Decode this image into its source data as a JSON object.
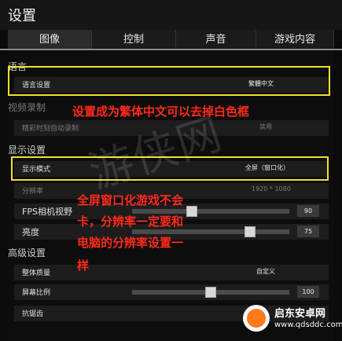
{
  "window": {
    "title": "设置"
  },
  "tabs": [
    {
      "label": "图像",
      "active": true
    },
    {
      "label": "控制",
      "active": false
    },
    {
      "label": "声音",
      "active": false
    },
    {
      "label": "游戏内容",
      "active": false
    }
  ],
  "sections": {
    "language": "语言",
    "video_recording": "视频录制",
    "display": "显示设置",
    "advanced": "高级设置"
  },
  "rows": {
    "language_setting": {
      "label": "语言设置",
      "value": "繁體中文"
    },
    "auto_record": {
      "label": "精彩时刻自动录制",
      "value": "禁用"
    },
    "display_mode": {
      "label": "显示模式",
      "value": "全屏（窗口化）"
    },
    "resolution": {
      "label": "分辨率",
      "value": "1920 * 1080"
    },
    "fps_fov": {
      "label": "FPS相机视野",
      "value": "90",
      "level": 0.38
    },
    "brightness": {
      "label": "亮度",
      "value": "75",
      "level": 0.75
    },
    "overall_quality": {
      "label": "整体质量",
      "value": "自定义"
    },
    "screen_scale": {
      "label": "屏幕比例",
      "value": "100",
      "level": 0.5
    },
    "anti_aliasing": {
      "label": "抗锯齿"
    }
  },
  "annotations": {
    "note1": "设置成为繁体中文可以去掉白色框",
    "note2_line1": "全屏窗口化游戏不会",
    "note2_line2": "卡，分辨率一定要和",
    "note2_line3": "电脑的分辨率设置一",
    "note2_line4": "样"
  },
  "colors": {
    "highlight": "#f0e02c",
    "annotation": "#ff2a1a",
    "background": "#0b0b0b"
  },
  "logo": {
    "name": "启东安卓网",
    "url": "www.qdsddc.com"
  },
  "watermark": "游侠网"
}
